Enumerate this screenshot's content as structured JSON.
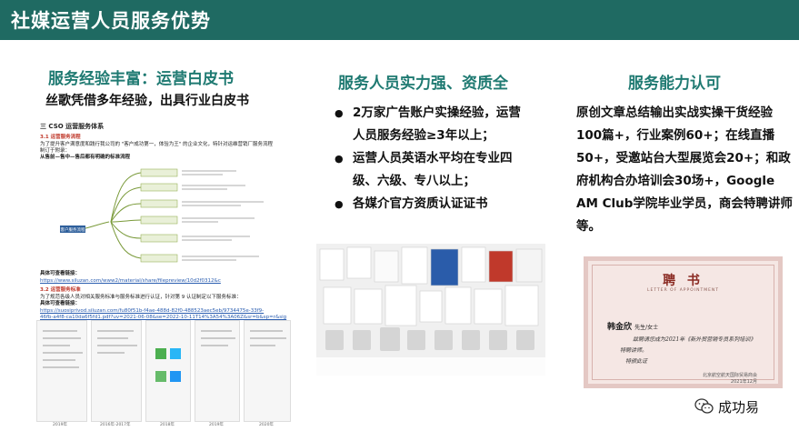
{
  "header": {
    "title": "社媒运营人员服务优势"
  },
  "columns": {
    "left": {
      "title": "服务经验丰富：运营白皮书",
      "subtitle": "丝歌凭借多年经验，出具行业白皮书",
      "doc": {
        "section": "三  CSO 运营服务体系",
        "s31": "3.1  运营服务流程",
        "p1": "为了提升客户满意度和践行我公司的 \"客户成功第一，体验为王\" 的企业文化，特针对运维营销厂服务流程",
        "p2": "制订于附录：",
        "p3": "从售前—售中—售后都有明确的标准流程",
        "center_node": "客户服务流程",
        "link_label": "具体可查看链接：",
        "link1": "https://www.siluzan.com/www2/material/share/filepreview/10d2f0312&c",
        "s32": "3.2  运营服务标准",
        "p4": "为了规范各级人员对相关服务标准与服务标准进行认证，针对第 9 认证制定以下服务标准：",
        "link_label2": "具体可查看链接：",
        "link2": "https://suosiprivod.siluzan.com/fu80f51b-f4ae-488d-82f0-488523aec5eb/9734475e-33f9-",
        "link3": "46fb-a4f8-ca10da6f5fd1.pdf?uv=2021-06-08&se=2022-10-11T14%3A54%3A06Z&sr=b&sp=r&sig",
        "thumb_labels": [
          "2019年",
          "2016年-2017年",
          "2018年",
          "2019年",
          "2020年"
        ]
      }
    },
    "middle": {
      "title": "服务人员实力强、资质全",
      "bullets": [
        "2万家广告账户实操经验，运营人员服务经验≥3年以上；",
        "运营人员英语水平均在专业四级、六级、专八以上；",
        "各媒介官方资质认证证书"
      ]
    },
    "right": {
      "title": "服务能力认可",
      "lines": [
        "原创文章总结输出实战实操干货经验",
        "100篇+，行业案例60+；在线直播",
        "50+，受邀站台大型展览会20+；和政",
        "府机构合办培训会30场+，Google",
        "AM Club学院毕业学员，商会特聘讲师",
        "等。"
      ],
      "certificate": {
        "heading": "聘 书",
        "sub": "LETTER OF APPOINTMENT",
        "name": "韩金欣",
        "name_suffix": "先生/女士",
        "line1": "兹聘请您成为2021年《新外贸营销专员系列培训》",
        "line2": "特聘讲师。",
        "line3": "特颁此证",
        "org": "北京航空航天国际贸易商会",
        "date": "2021年12月"
      }
    }
  },
  "footer": {
    "wechat_label": "成功易"
  },
  "colors": {
    "header": "#1f6a62",
    "accent": "#1f7a72"
  }
}
